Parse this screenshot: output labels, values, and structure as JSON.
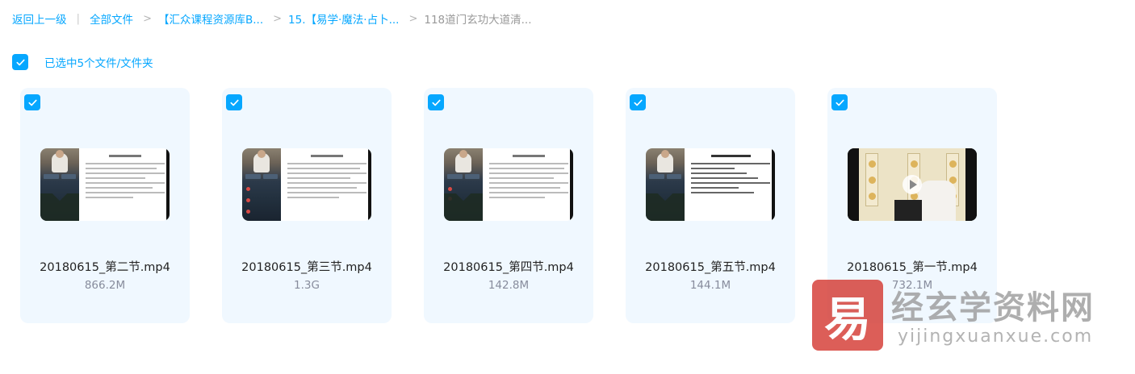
{
  "breadcrumb": {
    "back": "返回上一级",
    "items": [
      "全部文件",
      "【汇众课程资源库B...",
      "15.【易学·魔法·占卜...",
      "118道门玄功大道清..."
    ]
  },
  "selection": {
    "label": "已选中5个文件/文件夹",
    "checked": true
  },
  "files": [
    {
      "name": "20180615_第二节.mp4",
      "size": "866.2M",
      "thumb": "slide"
    },
    {
      "name": "20180615_第三节.mp4",
      "size": "1.3G",
      "thumb": "slide"
    },
    {
      "name": "20180615_第四节.mp4",
      "size": "142.8M",
      "thumb": "slide"
    },
    {
      "name": "20180615_第五节.mp4",
      "size": "144.1M",
      "thumb": "slide"
    },
    {
      "name": "20180615_第一节.mp4",
      "size": "732.1M",
      "thumb": "video"
    }
  ],
  "watermark": {
    "logo_char": "易",
    "title": "经玄学资料网",
    "url": "yijingxuanxue.com"
  },
  "colors": {
    "accent": "#06a7ff",
    "card_bg": "#f0f8ff",
    "size_text": "#878c9c"
  },
  "icons": {
    "checkbox": "check-icon",
    "play": "play-icon"
  }
}
